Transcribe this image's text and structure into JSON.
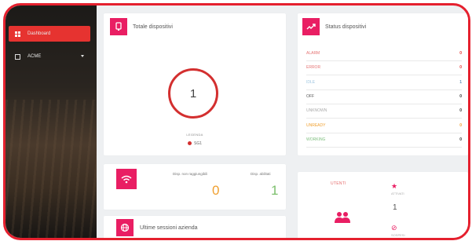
{
  "sidebar": {
    "items": [
      {
        "label": "Dashboard",
        "icon": "dashboard-icon",
        "active": true
      },
      {
        "label": "ACME",
        "icon": "building-icon",
        "active": false
      }
    ]
  },
  "total_devices": {
    "title": "Totale dispositivi",
    "count": "1",
    "legend_title": "LEGENDA",
    "legend_item": "SG1",
    "legend_color": "#d32f2f"
  },
  "status_devices": {
    "title": "Status dispositivi",
    "rows": [
      {
        "label": "ALARM",
        "value": "0",
        "label_color": "#e57373",
        "value_color": "#e53935"
      },
      {
        "label": "ERROR",
        "value": "0",
        "label_color": "#e57373",
        "value_color": "#e53935"
      },
      {
        "label": "IDLE",
        "value": "1",
        "label_color": "#9fc6e0",
        "value_color": "#5a8fb8"
      },
      {
        "label": "OFF",
        "value": "0",
        "label_color": "#555555",
        "value_color": "#333333"
      },
      {
        "label": "UNKNOWN",
        "value": "0",
        "label_color": "#aaaaaa",
        "value_color": "#333333"
      },
      {
        "label": "UNREADY",
        "value": "0",
        "label_color": "#f0a030",
        "value_color": "#f0a030"
      },
      {
        "label": "WORKING",
        "value": "0",
        "label_color": "#7fbf7f",
        "value_color": "#333333"
      }
    ]
  },
  "connectivity": {
    "unreachable_label": "Disp. non raggiungibili",
    "unreachable_value": "0",
    "enabled_label": "Disp. abilitati",
    "enabled_value": "1"
  },
  "users": {
    "title": "UTENTI",
    "active_label": "ATTIVATI",
    "active_value": "1",
    "disabled_label": "SOSPESI"
  },
  "sessions": {
    "title": "Ultime sessioni azienda"
  },
  "colors": {
    "accent": "#e91e63",
    "active_nav": "#e63330"
  }
}
